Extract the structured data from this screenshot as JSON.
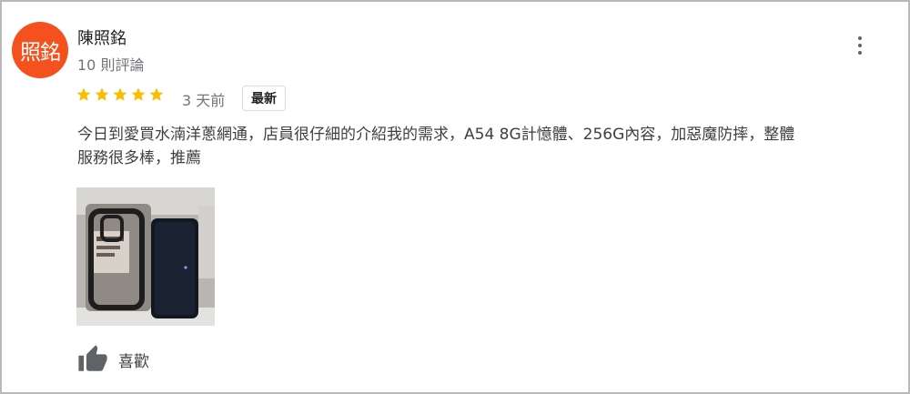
{
  "reviewer": {
    "avatar_text": "照銘",
    "avatar_color": "#f4511e",
    "name": "陳照銘",
    "review_count": "10 則評論"
  },
  "review": {
    "rating": 5,
    "age": "3 天前",
    "badge": "最新",
    "text": "今日到愛買水湳洋蔥網通，店員很仔細的介紹我的需求，A54 8G計憶體、256G內容，加惡魔防摔，整體\n服務很多棒，推薦"
  },
  "actions": {
    "like_label": "喜歡",
    "like_icon": "thumbs-up-icon",
    "more_icon": "more-vert-icon"
  },
  "colors": {
    "star": "#fbbc04",
    "secondary_text": "#70757a",
    "icon": "#5f6368"
  }
}
